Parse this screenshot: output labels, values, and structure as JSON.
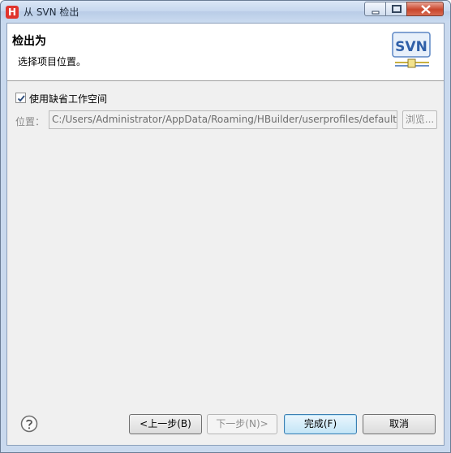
{
  "window": {
    "title": "从 SVN 检出",
    "app_icon_letter": "H",
    "controls": [
      "minimize",
      "maximize",
      "close"
    ]
  },
  "header": {
    "title": "检出为",
    "description": "选择项目位置。",
    "logo_text": "SVN"
  },
  "options": {
    "use_default_workspace_label": "使用缺省工作空间",
    "use_default_workspace_checked": true
  },
  "location": {
    "label": "位置：",
    "value": "C:/Users/Administrator/AppData/Roaming/HBuilder/userprofiles/default",
    "browse_label": "浏览..."
  },
  "footer": {
    "back_label": "<上一步(B)",
    "next_label": "下一步(N)>",
    "finish_label": "完成(F)",
    "cancel_label": "取消"
  },
  "colors": {
    "accent": "#3c7fb1",
    "close_button": "#c9462c",
    "app_icon": "#e0342d"
  }
}
